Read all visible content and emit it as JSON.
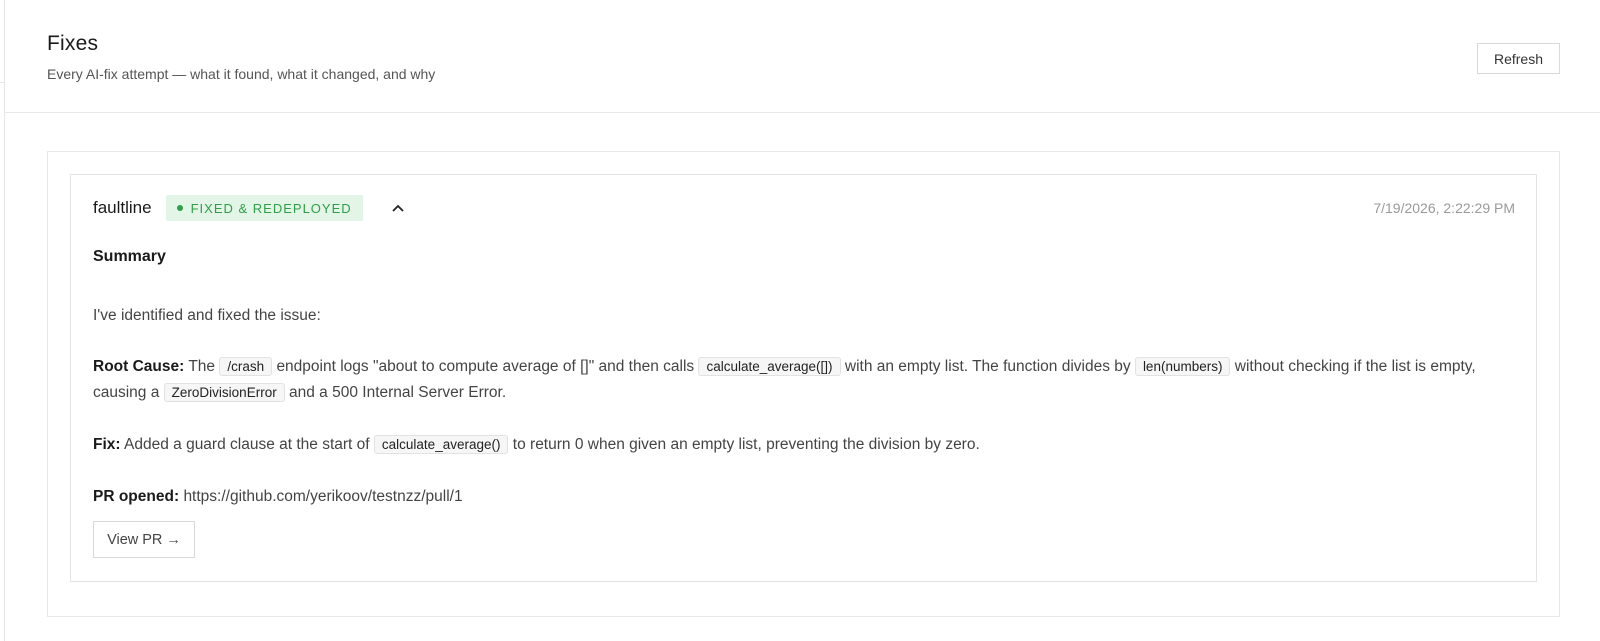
{
  "header": {
    "title": "Fixes",
    "subtitle": "Every AI-fix attempt — what it found, what it changed, and why",
    "refresh_label": "Refresh"
  },
  "fix": {
    "project": "faultline",
    "status": "FIXED & REDEPLOYED",
    "status_color": "#2e9f48",
    "status_bg": "#e3f5e6",
    "collapse_icon": "chevron-up-icon",
    "timestamp": "7/19/2026, 2:22:29 PM",
    "summary_heading": "Summary",
    "intro": "I've identified and fixed the issue:",
    "root_cause": {
      "label": "Root Cause:",
      "t1": "The",
      "c1": "/crash",
      "t2": "endpoint logs \"about to compute average of []\" and then calls",
      "c2": "calculate_average([])",
      "t3": "with an empty list. The function divides by",
      "c3": "len(numbers)",
      "t4": "without checking if the list is empty, causing a",
      "c4": "ZeroDivisionError",
      "t5": "and a 500 Internal Server Error."
    },
    "fix_text": {
      "label": "Fix:",
      "t1": "Added a guard clause at the start of",
      "c1": "calculate_average()",
      "t2": "to return 0 when given an empty list, preventing the division by zero."
    },
    "pr": {
      "label": "PR opened:",
      "url": "https://github.com/yerikoov/testnzz/pull/1",
      "button_label": "View PR →"
    }
  }
}
